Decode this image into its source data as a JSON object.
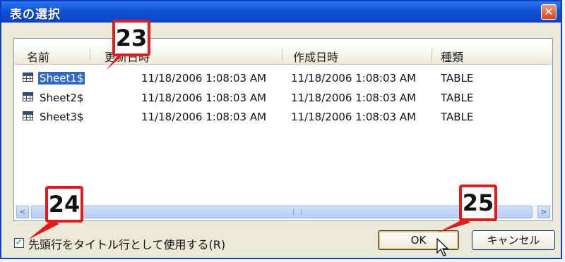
{
  "window": {
    "title": "表の選択",
    "close_label": "✕"
  },
  "columns": [
    "名前",
    "更新日時",
    "作成日時",
    "種類"
  ],
  "rows": [
    {
      "name": "Sheet1$",
      "modified": "11/18/2006 1:08:03 AM",
      "created": "11/18/2006 1:08:03 AM",
      "type": "TABLE"
    },
    {
      "name": "Sheet2$",
      "modified": "11/18/2006 1:08:03 AM",
      "created": "11/18/2006 1:08:03 AM",
      "type": "TABLE"
    },
    {
      "name": "Sheet3$",
      "modified": "11/18/2006 1:08:03 AM",
      "created": "11/18/2006 1:08:03 AM",
      "type": "TABLE"
    }
  ],
  "scroll": {
    "left": "<",
    "right": ">"
  },
  "checkbox": {
    "checked": true,
    "mark": "✓",
    "label": "先頭行をタイトル行として使用する(R)"
  },
  "buttons": {
    "ok": "OK",
    "cancel": "キャンセル"
  },
  "callouts": [
    "23",
    "24",
    "25"
  ],
  "colors": {
    "title_bar": "#0f52d6",
    "selection": "#316ac5",
    "callout_border": "#e31b1b"
  }
}
